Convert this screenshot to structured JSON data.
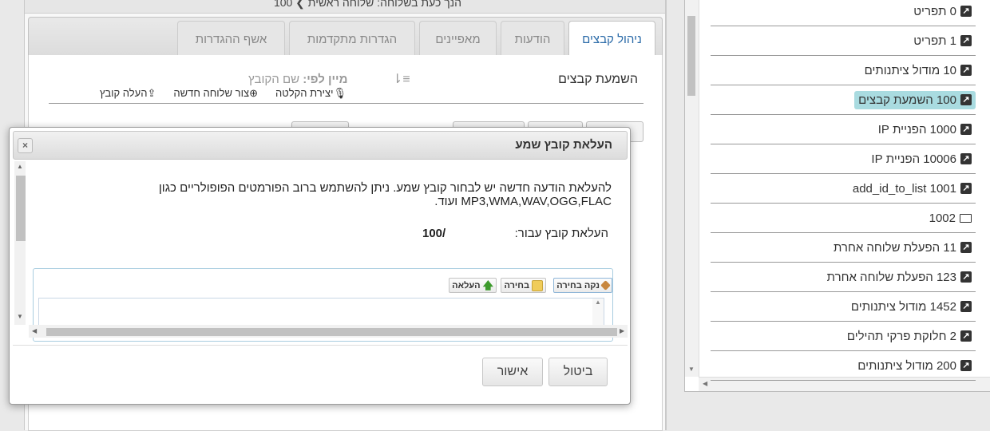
{
  "header": {
    "current_extension_text": "הנך כעת בשלוחה: שלוחה ראשית ❯ 100"
  },
  "tabs": [
    {
      "label": "ניהול קבצים",
      "active": true
    },
    {
      "label": "הודעות",
      "active": false
    },
    {
      "label": "מאפיינים",
      "active": false
    },
    {
      "label": "הגדרות מתקדמות",
      "active": false
    },
    {
      "label": "אשף ההגדרות",
      "active": false
    }
  ],
  "files_section": {
    "title": "השמעת קבצים",
    "sort_prefix": "מיין לפי:",
    "sort_value": "שם הקובץ",
    "toolbar": {
      "recording": "יצירת הקלטה",
      "new_extension": "צור שלוחה חדשה",
      "upload_file": "העלה קובץ"
    }
  },
  "tree": {
    "items": [
      {
        "label": "0 תפריט",
        "icon": "link-icon",
        "selected": false
      },
      {
        "label": "1 תפריט",
        "icon": "link-icon",
        "selected": false
      },
      {
        "label": "10 מודול ציתנותים",
        "icon": "link-icon",
        "selected": false
      },
      {
        "label": "100 השמעת קבצים",
        "icon": "link-icon",
        "selected": true
      },
      {
        "label": "1000 הפניית IP",
        "icon": "link-icon",
        "selected": false
      },
      {
        "label": "10006 הפניית IP",
        "icon": "link-icon",
        "selected": false
      },
      {
        "label": "1001 add_id_to_list",
        "icon": "link-icon",
        "selected": false
      },
      {
        "label": "1002",
        "icon": "folder-icon",
        "selected": false
      },
      {
        "label": "11 הפעלת שלוחה אחרת",
        "icon": "link-icon",
        "selected": false
      },
      {
        "label": "123 הפעלת שלוחה אחרת",
        "icon": "link-icon",
        "selected": false
      },
      {
        "label": "1452 מודול ציתנותים",
        "icon": "link-icon",
        "selected": false
      },
      {
        "label": "2 חלוקת פרקי תהילים",
        "icon": "link-icon",
        "selected": false
      },
      {
        "label": "200 מודול ציתנותים",
        "icon": "link-icon",
        "selected": false
      }
    ]
  },
  "modal": {
    "title": "העלאת קובץ שמע",
    "close_symbol": "×",
    "description": "להעלאת הודעה חדשה יש לבחור קובץ שמע. ניתן להשתמש ברוב הפורמטים הפופולריים כגון MP3,WMA,WAV,OGG,FLAC ועוד.",
    "upload_for_label": "העלאת קובץ עבור:",
    "upload_for_value": "100/",
    "uploader_buttons": {
      "clear": "נקה בחירה",
      "choose": "בחירה",
      "upload": "העלאה"
    },
    "cancel_label": "ביטול",
    "confirm_label": "אישור"
  },
  "colors": {
    "selected_tree_item": "#a9dbe0",
    "active_tab_text": "#2a6aa8"
  }
}
